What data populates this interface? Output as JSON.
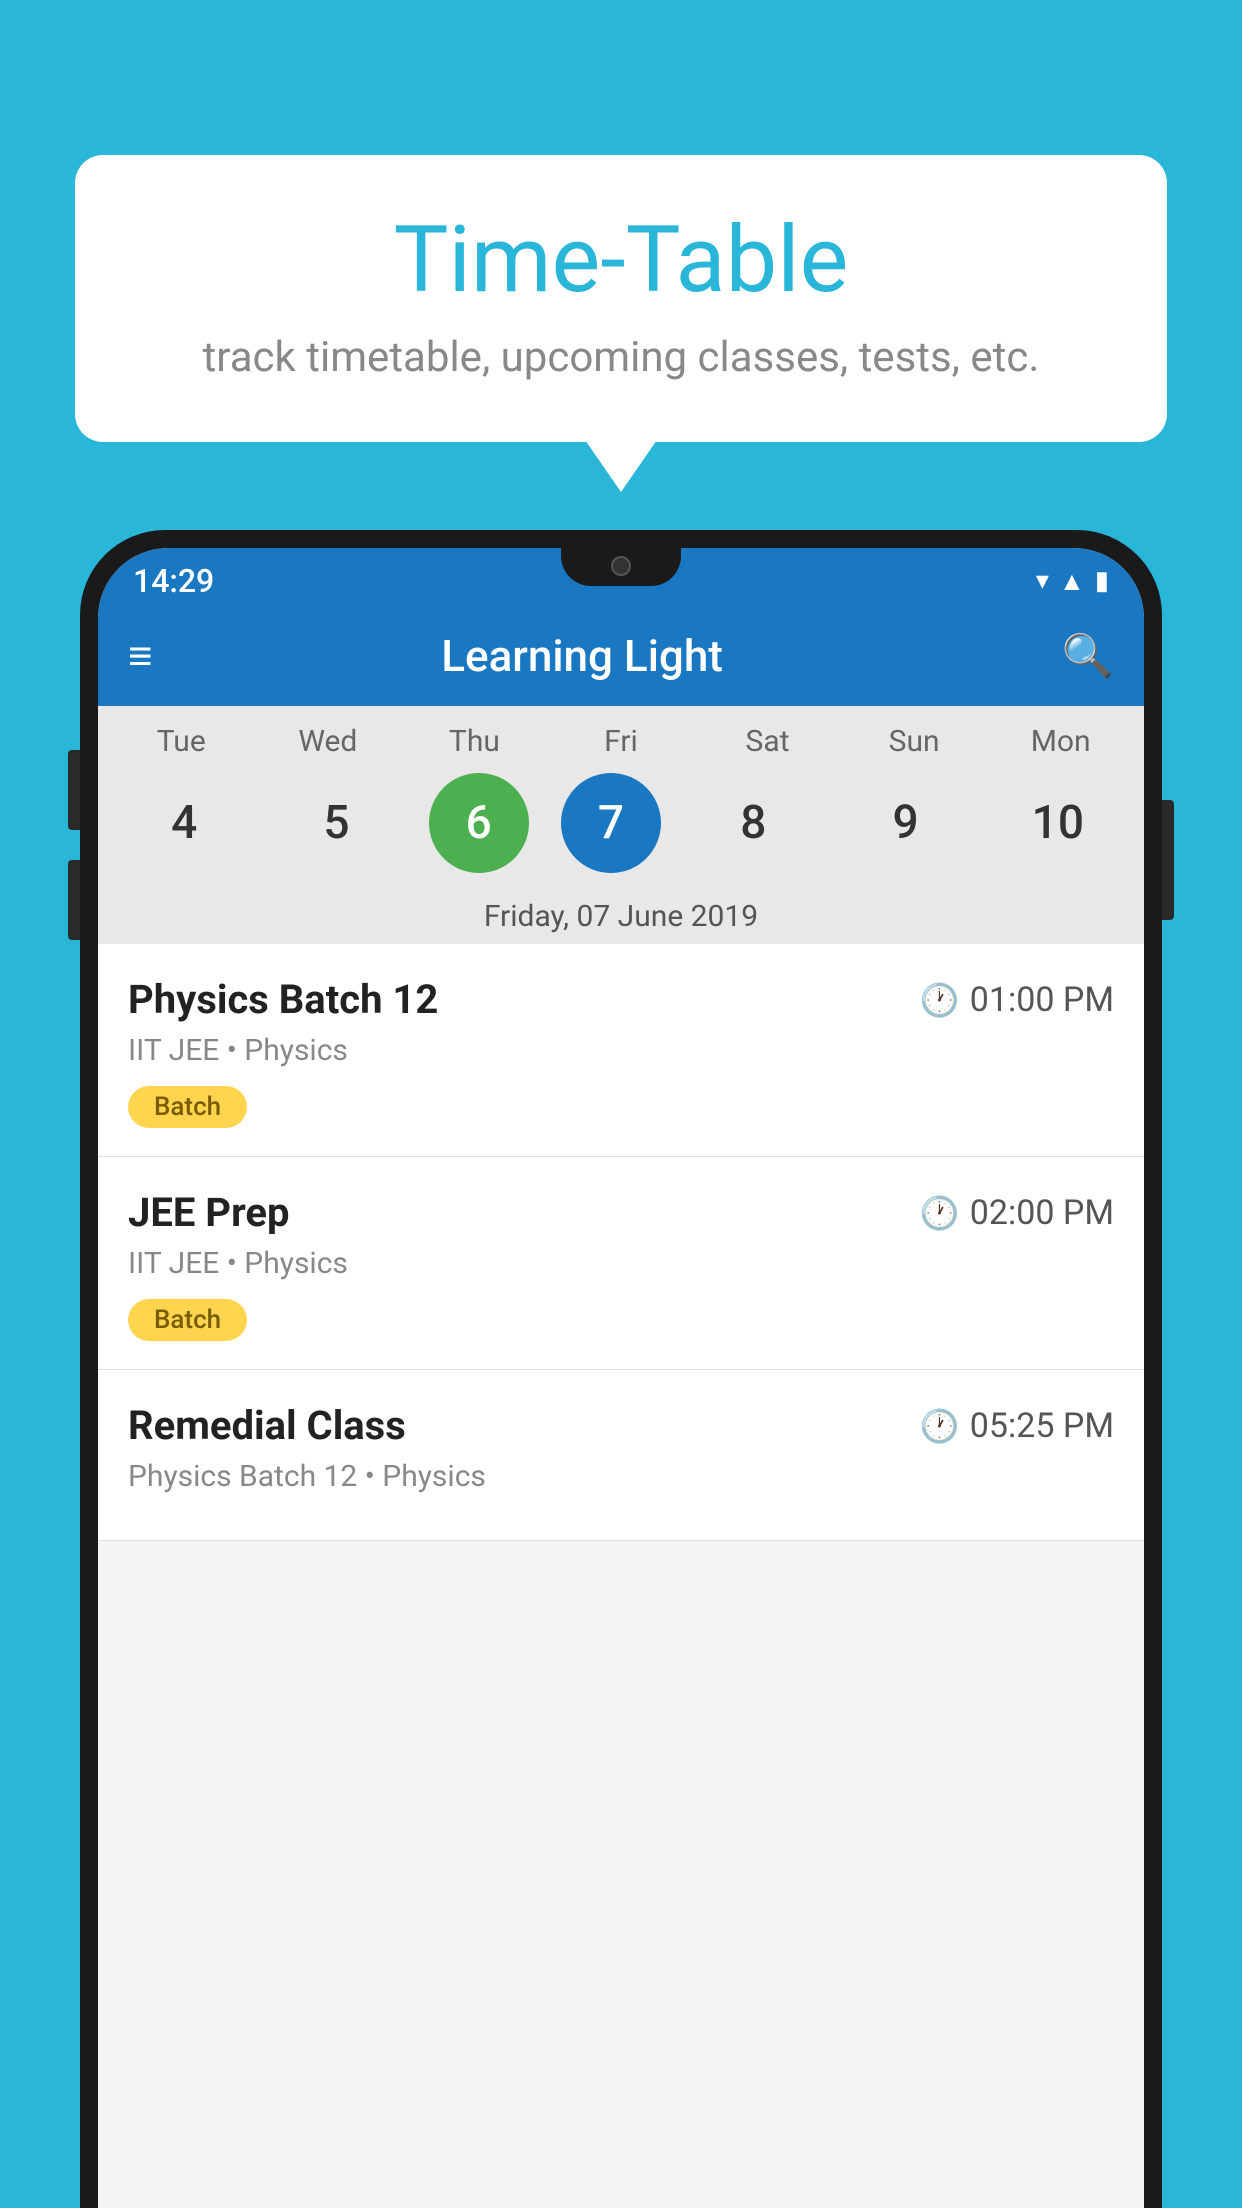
{
  "background_color": "#29b6d8",
  "bubble": {
    "title": "Time-Table",
    "subtitle": "track timetable, upcoming classes, tests, etc."
  },
  "phone": {
    "status_bar": {
      "time": "14:29"
    },
    "toolbar": {
      "title": "Learning Light"
    },
    "calendar": {
      "days": [
        {
          "label": "Tue",
          "num": "4"
        },
        {
          "label": "Wed",
          "num": "5"
        },
        {
          "label": "Thu",
          "num": "6",
          "state": "today"
        },
        {
          "label": "Fri",
          "num": "7",
          "state": "selected"
        },
        {
          "label": "Sat",
          "num": "8"
        },
        {
          "label": "Sun",
          "num": "9"
        },
        {
          "label": "Mon",
          "num": "10"
        }
      ],
      "selected_date_label": "Friday, 07 June 2019"
    },
    "schedule": [
      {
        "title": "Physics Batch 12",
        "time": "01:00 PM",
        "subtitle": "IIT JEE • Physics",
        "badge": "Batch"
      },
      {
        "title": "JEE Prep",
        "time": "02:00 PM",
        "subtitle": "IIT JEE • Physics",
        "badge": "Batch"
      },
      {
        "title": "Remedial Class",
        "time": "05:25 PM",
        "subtitle": "Physics Batch 12 • Physics",
        "badge": null
      }
    ]
  }
}
